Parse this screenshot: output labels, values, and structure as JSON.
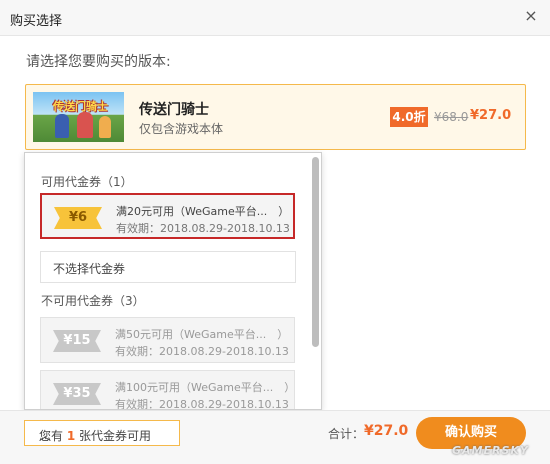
{
  "dialog": {
    "title": "购买选择",
    "close": "×"
  },
  "prompt": "请选择您要购买的版本:",
  "product": {
    "name": "传送门骑士",
    "subtitle": "仅包含游戏本体",
    "discount": "4.0折",
    "original_price": "¥68.0",
    "price": "¥27.0",
    "thumb_logo": "传送门骑士"
  },
  "coupons": {
    "available_title": "可用代金券（1）",
    "available": [
      {
        "amount": "¥6",
        "condition": "满20元可用（WeGame平台...　）",
        "validity": "有效期：2018.08.29-2018.10.13",
        "selected": true
      }
    ],
    "none_option": "不选择代金券",
    "unavailable_title": "不可用代金券（3）",
    "unavailable": [
      {
        "amount": "¥15",
        "condition": "满50元可用（WeGame平台...　）",
        "validity": "有效期：2018.08.29-2018.10.13"
      },
      {
        "amount": "¥35",
        "condition": "满100元可用（WeGame平台...　）",
        "validity": "有效期：2018.08.29-2018.10.13"
      }
    ]
  },
  "footer": {
    "coupon_pre": "您有 ",
    "coupon_count": "1",
    "coupon_post": " 张代金券可用",
    "chevron": "︿",
    "total_label": "合计：",
    "total_value": "¥27.0",
    "confirm": "确认购买"
  },
  "watermark": "GAMERSKY",
  "colors": {
    "accent": "#f06a2a",
    "button": "#f08c1e",
    "highlight_border": "#c62828",
    "product_border": "#f5b94b"
  }
}
